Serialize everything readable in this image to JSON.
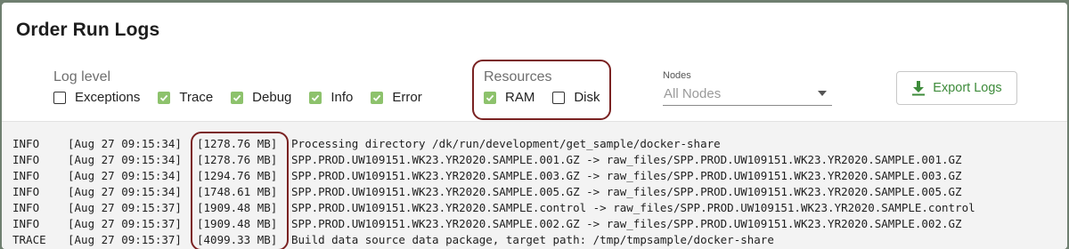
{
  "dialog": {
    "title": "Order Run Logs"
  },
  "log_level": {
    "label": "Log level",
    "options": [
      {
        "label": "Exceptions",
        "checked": false
      },
      {
        "label": "Trace",
        "checked": true
      },
      {
        "label": "Debug",
        "checked": true
      },
      {
        "label": "Info",
        "checked": true
      },
      {
        "label": "Error",
        "checked": true
      }
    ]
  },
  "resources": {
    "label": "Resources",
    "options": [
      {
        "label": "RAM",
        "checked": true
      },
      {
        "label": "Disk",
        "checked": false
      }
    ]
  },
  "nodes": {
    "label": "Nodes",
    "value": "All Nodes"
  },
  "export": {
    "label": "Export Logs"
  },
  "colors": {
    "accent": "#8dc26c",
    "button_text": "#3d8b3a",
    "highlight": "#7a2222"
  },
  "logs": [
    {
      "level": "INFO",
      "time": "[Aug 27 09:15:34]",
      "mem": "[1278.76 MB]",
      "msg": "Processing directory /dk/run/development/get_sample/docker-share"
    },
    {
      "level": "INFO",
      "time": "[Aug 27 09:15:34]",
      "mem": "[1278.76 MB]",
      "msg": "SPP.PROD.UW109151.WK23.YR2020.SAMPLE.001.GZ -> raw_files/SPP.PROD.UW109151.WK23.YR2020.SAMPLE.001.GZ"
    },
    {
      "level": "INFO",
      "time": "[Aug 27 09:15:34]",
      "mem": "[1294.76 MB]",
      "msg": "SPP.PROD.UW109151.WK23.YR2020.SAMPLE.003.GZ -> raw_files/SPP.PROD.UW109151.WK23.YR2020.SAMPLE.003.GZ"
    },
    {
      "level": "INFO",
      "time": "[Aug 27 09:15:34]",
      "mem": "[1748.61 MB]",
      "msg": "SPP.PROD.UW109151.WK23.YR2020.SAMPLE.005.GZ -> raw_files/SPP.PROD.UW109151.WK23.YR2020.SAMPLE.005.GZ"
    },
    {
      "level": "INFO",
      "time": "[Aug 27 09:15:37]",
      "mem": "[1909.48 MB]",
      "msg": "SPP.PROD.UW109151.WK23.YR2020.SAMPLE.control -> raw_files/SPP.PROD.UW109151.WK23.YR2020.SAMPLE.control"
    },
    {
      "level": "INFO",
      "time": "[Aug 27 09:15:37]",
      "mem": "[1909.48 MB]",
      "msg": "SPP.PROD.UW109151.WK23.YR2020.SAMPLE.002.GZ -> raw_files/SPP.PROD.UW109151.WK23.YR2020.SAMPLE.002.GZ"
    },
    {
      "level": "TRACE",
      "time": "[Aug 27 09:15:37]",
      "mem": "[4099.33 MB]",
      "msg": "Build data source data package, target path: /tmp/tmpsample/docker-share"
    }
  ]
}
